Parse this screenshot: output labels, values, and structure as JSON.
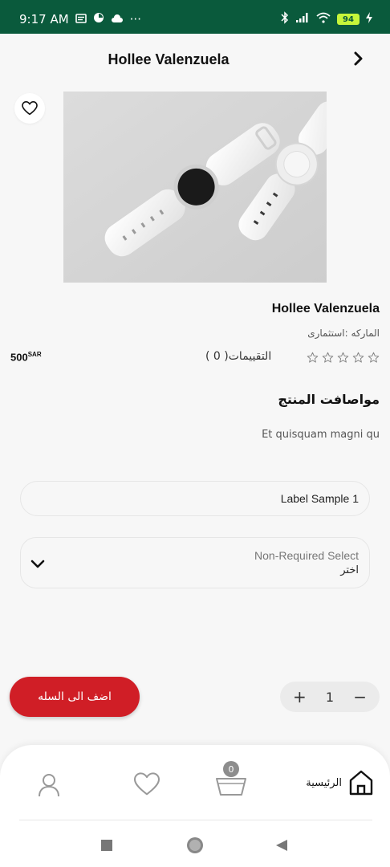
{
  "status_bar": {
    "time": "9:17 AM",
    "more": "···",
    "battery": "94",
    "colors": {
      "background": "#0a5a3c",
      "battery": "#c6f53a"
    }
  },
  "header": {
    "title": "Hollee Valenzuela",
    "back_icon": "chevron-right-icon"
  },
  "product": {
    "name": "Hollee Valenzuela",
    "brand": "الماركه :استثمارى",
    "price": "500",
    "currency": "SAR",
    "rating": 0,
    "reviews_label": "التقييمات( 0 )",
    "favorite_icon": "heart-outline-icon"
  },
  "specs": {
    "title": "مواصافت المنتج",
    "description": "Et quisquam magni qu"
  },
  "form": {
    "text_field_value": "Label Sample 1",
    "select_label": "Non-Required Select",
    "select_placeholder": "اختر"
  },
  "actions": {
    "add_to_cart": "اضف الى السله",
    "quantity": "1",
    "plus": "+",
    "minus": "−",
    "accent_color": "#d01e26"
  },
  "bottom_nav": {
    "home_label": "الرئيسية",
    "cart_count": "0",
    "items": [
      "home-icon",
      "cart-icon",
      "heart-icon",
      "profile-icon"
    ]
  }
}
